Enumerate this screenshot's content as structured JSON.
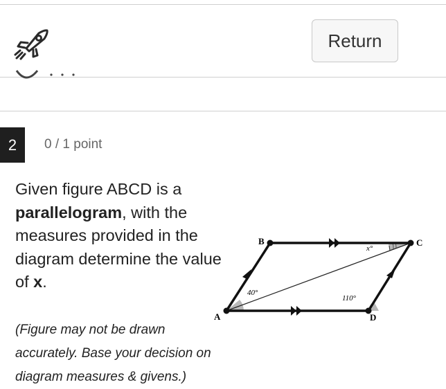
{
  "header": {
    "return_label": "Return",
    "logo_icon": "rocket-icon"
  },
  "question": {
    "number": "2",
    "points": "0 / 1 point",
    "text_before": "Given figure ABCD is a ",
    "text_bold": "parallelogram",
    "text_middle": ", with the measures provided in the diagram determine the value of ",
    "text_variable": "x",
    "text_end": ".",
    "note": "(Figure may not be drawn accurately. Base your decision on diagram measures & givens.)"
  },
  "diagram": {
    "vertex_a": "A",
    "vertex_b": "B",
    "vertex_c": "C",
    "vertex_d": "D",
    "angle_a": "40°",
    "angle_c": "x°",
    "angle_d": "110°"
  },
  "colors": {
    "question_number_bg": "#1f1f1f",
    "divider": "#cfcfcf",
    "angle_fill": "#b8b8b8"
  }
}
